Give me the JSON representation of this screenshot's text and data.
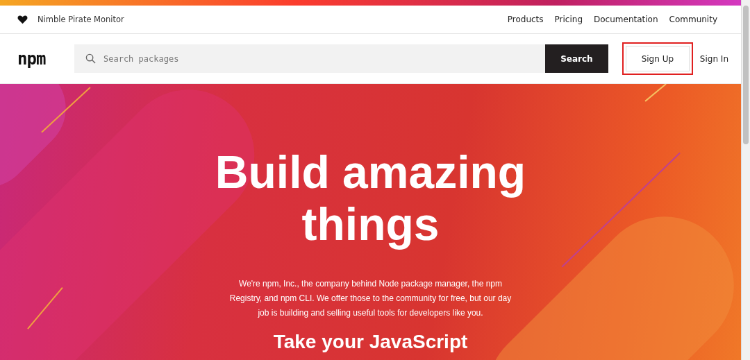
{
  "top_bar": {
    "brand": "Nimble Pirate Monitor",
    "links": [
      "Products",
      "Pricing",
      "Documentation",
      "Community"
    ]
  },
  "header": {
    "logo": "npm",
    "search": {
      "placeholder": "Search packages",
      "button": "Search"
    },
    "sign_up": {
      "label": "Sign Up",
      "highlighted": true
    },
    "sign_in": "Sign In"
  },
  "hero": {
    "title": "Build amazing things",
    "description": "We're npm, Inc., the company behind Node package manager, the npm Registry, and npm CLI. We offer those to the community for free, but our day job is building and selling useful tools for developers like you.",
    "subtitle": "Take your JavaScript"
  }
}
